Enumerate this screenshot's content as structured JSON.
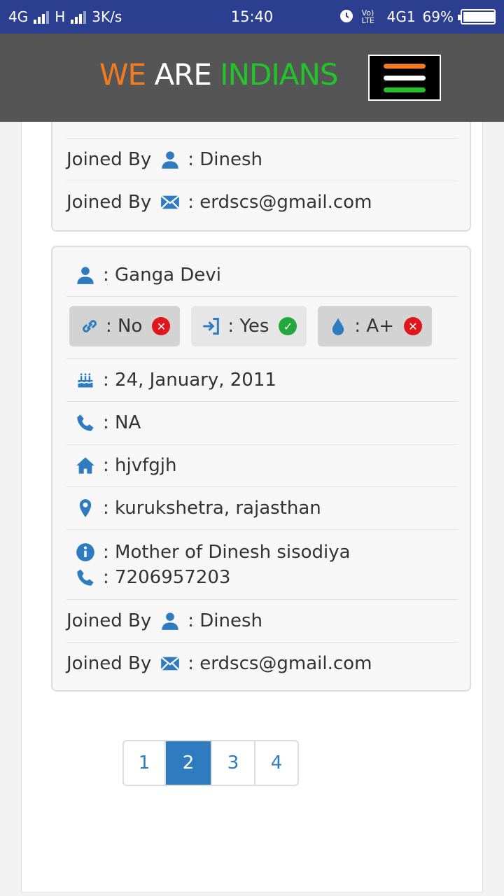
{
  "statusbar": {
    "network1": "4G",
    "network2": "H",
    "speed": "3K/s",
    "time": "15:40",
    "volte": "Vo) LTE",
    "network3": "4G1",
    "battery": "69%"
  },
  "header": {
    "brand_word1": "WE",
    "brand_word2": "ARE",
    "brand_word3": "INDIANS"
  },
  "colors": {
    "orange": "#f47a1f",
    "green": "#22c42a",
    "blue": "#2f7bbf"
  },
  "card1": {
    "joined_label": "Joined By",
    "joined_name": ": Dinesh",
    "joined_email": ": erdscs@gmail.com"
  },
  "card2": {
    "name": ": Ganga Devi",
    "badge_link": ": No",
    "badge_join": ": Yes",
    "badge_blood": ": A+",
    "dob": ": 24, January, 2011",
    "phone": ": NA",
    "house": ": hjvfgjh",
    "location": ": kurukshetra, rajasthan",
    "info": ": Mother of Dinesh sisodiya",
    "info_phone": ": 7206957203",
    "joined_label": "Joined By",
    "joined_name": ": Dinesh",
    "joined_email": ": erdscs@gmail.com"
  },
  "pagination": {
    "pages": [
      "1",
      "2",
      "3",
      "4"
    ],
    "active": "2"
  }
}
